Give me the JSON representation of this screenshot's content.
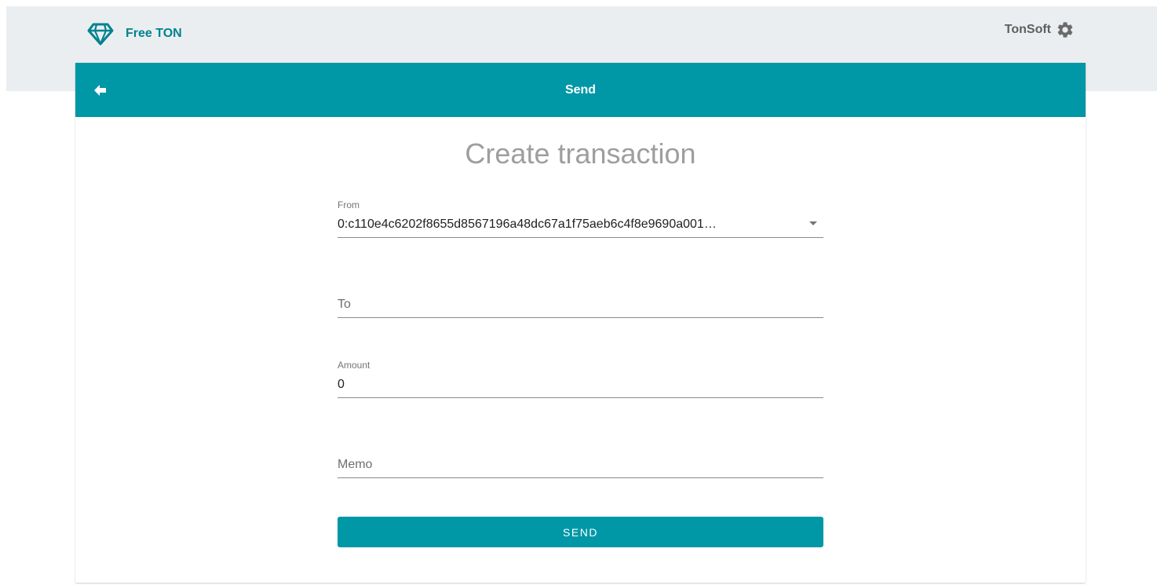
{
  "header": {
    "brand_name": "Free TON",
    "account_name": "TonSoft"
  },
  "appbar": {
    "title": "Send"
  },
  "page": {
    "title": "Create transaction"
  },
  "form": {
    "from": {
      "label": "From",
      "value": "0:c110e4c6202f8655d8567196a48dc67a1f75aeb6c4f8e9690a001…"
    },
    "to": {
      "placeholder": "To"
    },
    "amount": {
      "label": "Amount",
      "value": "0"
    },
    "memo": {
      "placeholder": "Memo"
    },
    "submit_label": "SEND"
  },
  "icons": {
    "logo": "diamond-icon",
    "settings": "gear-icon",
    "back": "arrow-left-icon",
    "dropdown": "caret-down-icon"
  },
  "colors": {
    "accent": "#0097a7",
    "brand_text": "#00838f",
    "header_band": "#ebeef0",
    "title_gray": "#9e9e9e"
  }
}
